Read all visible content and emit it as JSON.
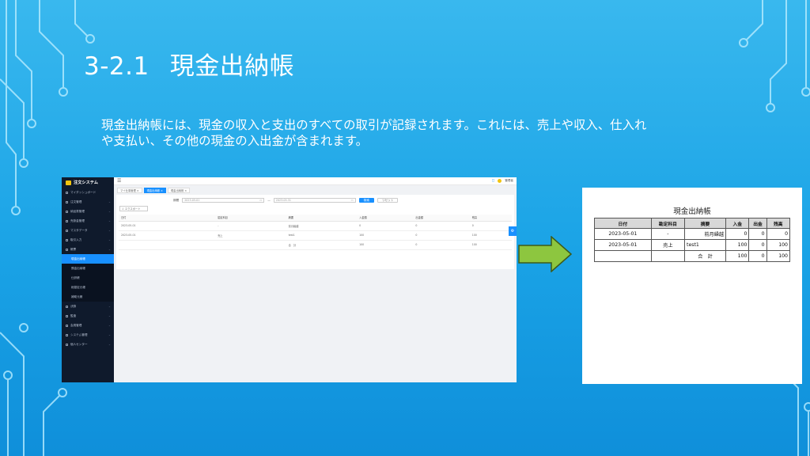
{
  "slide": {
    "number": "3-2.1",
    "title": "現金出納帳",
    "description": "現金出納帳には、現金の収入と支出のすべての取引が記録されます。これには、売上や収入、仕入れや支払い、その他の現金の入出金が含まれます。"
  },
  "app": {
    "logo_text": "注文システム",
    "sidebar_items": [
      {
        "label": "マイダッシュボード",
        "has_children": false
      },
      {
        "label": "注文管理",
        "has_children": true
      },
      {
        "label": "納品書管理",
        "has_children": true
      },
      {
        "label": "売掛金管理",
        "has_children": true
      },
      {
        "label": "マスタデータ",
        "has_children": true
      },
      {
        "label": "取引入力",
        "has_children": true
      }
    ],
    "ledger_section": "帳票",
    "ledger_sub": [
      "現金出納帳",
      "預金出納帳",
      "仕訳帳",
      "総勘定元帳",
      "補助元帳"
    ],
    "active_sub_index": 0,
    "sidebar_bottom": [
      "決算",
      "監査",
      "会員管理",
      "システム管理",
      "個人センター"
    ],
    "topbar_user": "管理者",
    "tabs": [
      {
        "label": "マイ仕事管理",
        "active": false
      },
      {
        "label": "現金出納帳",
        "active": true
      },
      {
        "label": "現金出納帳",
        "active": false
      }
    ],
    "filter_label": "期間",
    "date_from": "2023-05-01",
    "date_to": "2023-05-31",
    "search_label": "検索",
    "reset_label": "リセット",
    "export_label": "エクスポート",
    "columns": [
      "日付",
      "勘定科目",
      "摘要",
      "入金額",
      "出金額",
      "残高"
    ],
    "rows": [
      [
        "2023-05-01",
        "-",
        "前月繰越",
        "0",
        "0",
        "0"
      ],
      [
        "2023-05-01",
        "売上",
        "test1",
        "100",
        "0",
        "100"
      ],
      [
        "",
        "",
        "合　計",
        "100",
        "0",
        "100"
      ]
    ],
    "float_icon": "gear-icon"
  },
  "document": {
    "title": "現金出納帳",
    "columns": [
      "日付",
      "勘定科目",
      "摘要",
      "入金",
      "出金",
      "残高"
    ],
    "rows": [
      [
        "2023-05-01",
        "-",
        "前月繰越",
        "0",
        "0",
        "0"
      ],
      [
        "2023-05-01",
        "売上",
        "test1",
        "100",
        "0",
        "100"
      ],
      [
        "",
        "",
        "合　計",
        "100",
        "0",
        "100"
      ]
    ]
  },
  "colors": {
    "background": "#1aa3e6",
    "sidebar": "#0f1a2c",
    "accent": "#1890ff",
    "arrow": "#8dc63f"
  }
}
